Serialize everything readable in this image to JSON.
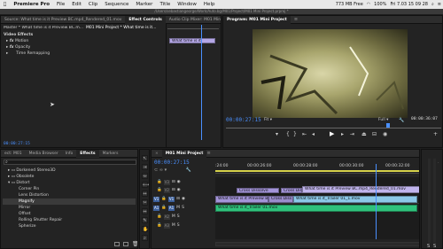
{
  "menubar": {
    "apple": "",
    "app": "Premiere Pro",
    "items": [
      "File",
      "Edit",
      "Clip",
      "Sequence",
      "Marker",
      "Title",
      "Window",
      "Help"
    ],
    "status": {
      "memory": "773 MB Free",
      "battery": "100%",
      "time": "Fri 7.03  15 09 28"
    }
  },
  "window_title": "/Users/sebastiangeorge/Work/Auto.bg/M01/Project/M01 Mini Project.prproj *",
  "source_panel": {
    "tabs": [
      "Source: What time is it Preview BC.mp4_Rendered_01.mov",
      "Effect Controls",
      "Audio Clip Mixer: M01 Mini"
    ],
    "active_tab": 1,
    "master": "Master * What time is it Preview BC.m...",
    "sequence": "M01 Mini Project * What time is it...",
    "section": "Video Effects",
    "effects": [
      "Motion",
      "Opacity",
      "Time Remapping"
    ],
    "mini_clip": "What time is it",
    "timecode": "00:00:27:15"
  },
  "program_panel": {
    "tab": "Program: M01 Mini Project",
    "timecode": "00:00:27:15",
    "fit": "Fit",
    "quality": "Full",
    "duration": "00:00:36:07"
  },
  "project_panel": {
    "tabs": [
      "ect: M01",
      "Media Browser",
      "Info",
      "Effects",
      "Markers"
    ],
    "active_tab": 3,
    "folders": [
      "Obsolete",
      "Distort"
    ],
    "folder_prefix_item": "Darkened Stereo3D",
    "items": [
      "Corner Pin",
      "Lens Distortion",
      "Magnify",
      "Mirror",
      "Offset",
      "Rolling Shutter Repair",
      "Spherize"
    ],
    "selected_item": "Magnify"
  },
  "timeline": {
    "tab": "M01 Mini Project",
    "timecode": "00:00:27:15",
    "ruler": [
      ":24:00",
      "00:00:26:00",
      "00:00:28:00",
      "00:00:30:00",
      "00:00:32:00"
    ],
    "tracks": [
      {
        "target": "",
        "name": "V3",
        "row": 0
      },
      {
        "target": "",
        "name": "V2",
        "row": 1
      },
      {
        "target": "V1",
        "name": "V1",
        "row": 2
      },
      {
        "target": "A1",
        "name": "A1",
        "row": 3
      },
      {
        "target": "",
        "name": "A2",
        "row": 4
      },
      {
        "target": "",
        "name": "A3",
        "row": 5
      }
    ],
    "clips": {
      "v2_a": "Cross Dissolve",
      "v2_b": "Cross Diss",
      "v2_c": "What time is it Preview BC.mp4_Rendered_01.mov",
      "v1_a": "What time is it Preview B",
      "v1_b": "Cross Diss",
      "v1_c": "What time is it_Trailer 01_1.mov",
      "a1": "What time is it_Trailer 01.mov"
    }
  },
  "colors": {
    "accent": "#4a90ff",
    "clip_violet": "#a394d8",
    "clip_blue": "#8cc8e8",
    "clip_green": "#2fc27c",
    "playhead": "#4a90ff"
  }
}
